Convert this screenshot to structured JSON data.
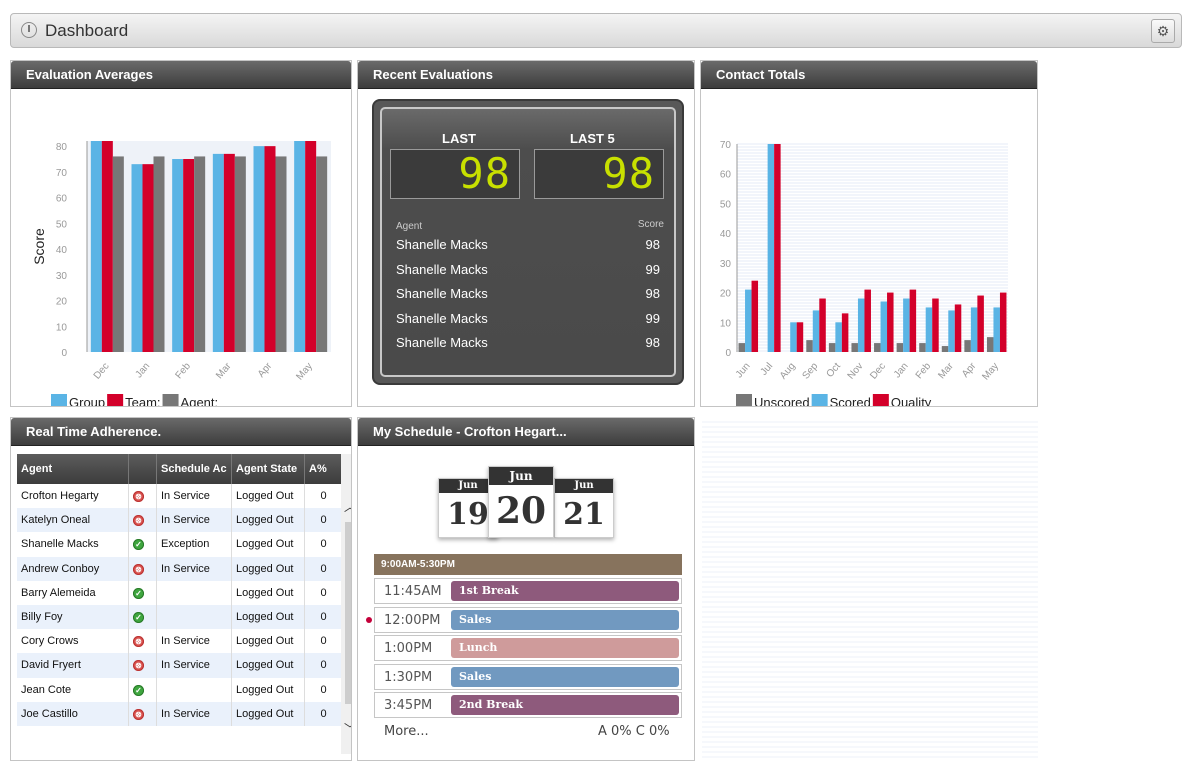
{
  "header": {
    "title": "Dashboard"
  },
  "panels": {
    "eval_averages": "Evaluation Averages",
    "recent_evals": "Recent Evaluations",
    "contact_totals": "Contact Totals",
    "rta": "Real Time Adherence.",
    "schedule": "My Schedule - Crofton Hegart..."
  },
  "recent": {
    "last_label": "LAST",
    "last5_label": "LAST 5",
    "last_value": "98",
    "last5_value": "98",
    "agent_col": "Agent",
    "score_col": "Score",
    "rows": [
      {
        "agent": "Shanelle Macks",
        "score": "98"
      },
      {
        "agent": "Shanelle Macks",
        "score": "99"
      },
      {
        "agent": "Shanelle Macks",
        "score": "98"
      },
      {
        "agent": "Shanelle Macks",
        "score": "99"
      },
      {
        "agent": "Shanelle Macks",
        "score": "98"
      }
    ]
  },
  "rta": {
    "headers": [
      "Agent",
      "",
      "Schedule Ac",
      "Agent State",
      "A%"
    ],
    "rows": [
      {
        "agent": "Crofton Hegarty",
        "status": "red",
        "activity": "In Service",
        "state": "Logged Out",
        "pct": "0"
      },
      {
        "agent": "Katelyn Oneal",
        "status": "red",
        "activity": "In Service",
        "state": "Logged Out",
        "pct": "0"
      },
      {
        "agent": "Shanelle Macks",
        "status": "green",
        "activity": "Exception",
        "state": "Logged Out",
        "pct": "0"
      },
      {
        "agent": "Andrew Conboy",
        "status": "red",
        "activity": "In Service",
        "state": "Logged Out",
        "pct": "0"
      },
      {
        "agent": "Barry Alemeida",
        "status": "green",
        "activity": "",
        "state": "Logged Out",
        "pct": "0"
      },
      {
        "agent": "Billy Foy",
        "status": "green",
        "activity": "",
        "state": "Logged Out",
        "pct": "0"
      },
      {
        "agent": "Cory Crows",
        "status": "red",
        "activity": "In Service",
        "state": "Logged Out",
        "pct": "0"
      },
      {
        "agent": "David Fryert",
        "status": "red",
        "activity": "In Service",
        "state": "Logged Out",
        "pct": "0"
      },
      {
        "agent": "Jean Cote",
        "status": "green",
        "activity": "",
        "state": "Logged Out",
        "pct": "0"
      },
      {
        "agent": "Joe Castillo",
        "status": "red",
        "activity": "In Service",
        "state": "Logged Out",
        "pct": "0"
      }
    ]
  },
  "schedule": {
    "days": [
      {
        "month": "Jun",
        "day": "19"
      },
      {
        "month": "Jun",
        "day": "20"
      },
      {
        "month": "Jun",
        "day": "21"
      }
    ],
    "shift": "9:00AM-5:30PM",
    "slots": [
      {
        "time": "11:45AM",
        "activity": "1st Break",
        "color": "#8e5a7c"
      },
      {
        "time": "12:00PM",
        "activity": "Sales",
        "color": "#7199c0"
      },
      {
        "time": "1:00PM",
        "activity": "Lunch",
        "color": "#cf9b9b"
      },
      {
        "time": "1:30PM",
        "activity": "Sales",
        "color": "#7199c0"
      },
      {
        "time": "3:45PM",
        "activity": "2nd Break",
        "color": "#8e5a7c"
      }
    ],
    "more": "More...",
    "ac": "A 0%  C 0%"
  },
  "chart_data": [
    {
      "type": "bar",
      "title": "",
      "ylabel": "Score",
      "ylim": [
        0,
        82
      ],
      "yticks": [
        0,
        10,
        20,
        30,
        40,
        50,
        60,
        70,
        80
      ],
      "categories": [
        "Dec",
        "Jan",
        "Feb",
        "Mar",
        "Apr",
        "May"
      ],
      "series": [
        {
          "name": "Group",
          "color": "#5ab4e5",
          "values": [
            82,
            73,
            75,
            77,
            80,
            82
          ]
        },
        {
          "name": "Team:",
          "color": "#d3002a",
          "values": [
            82,
            73,
            75,
            77,
            80,
            82
          ]
        },
        {
          "name": "Agent:",
          "color": "#777777",
          "values": [
            76,
            76,
            76,
            76,
            76,
            76
          ]
        }
      ]
    },
    {
      "type": "bar",
      "title": "",
      "ylim": [
        0,
        70
      ],
      "yticks": [
        0,
        10,
        20,
        30,
        40,
        50,
        60,
        70
      ],
      "categories": [
        "Jun",
        "Jul",
        "Aug",
        "Sep",
        "Oct",
        "Nov",
        "Dec",
        "Jan",
        "Feb",
        "Mar",
        "Apr",
        "May"
      ],
      "series": [
        {
          "name": "Unscored",
          "color": "#777777",
          "values": [
            3,
            0,
            0,
            4,
            3,
            3,
            3,
            3,
            3,
            2,
            4,
            5
          ]
        },
        {
          "name": "Scored",
          "color": "#5ab4e5",
          "values": [
            21,
            70,
            10,
            14,
            10,
            18,
            17,
            18,
            15,
            14,
            15,
            15
          ]
        },
        {
          "name": "Quality",
          "color": "#d3002a",
          "values": [
            24,
            70,
            10,
            18,
            13,
            21,
            20,
            21,
            18,
            16,
            19,
            20
          ]
        }
      ]
    }
  ]
}
